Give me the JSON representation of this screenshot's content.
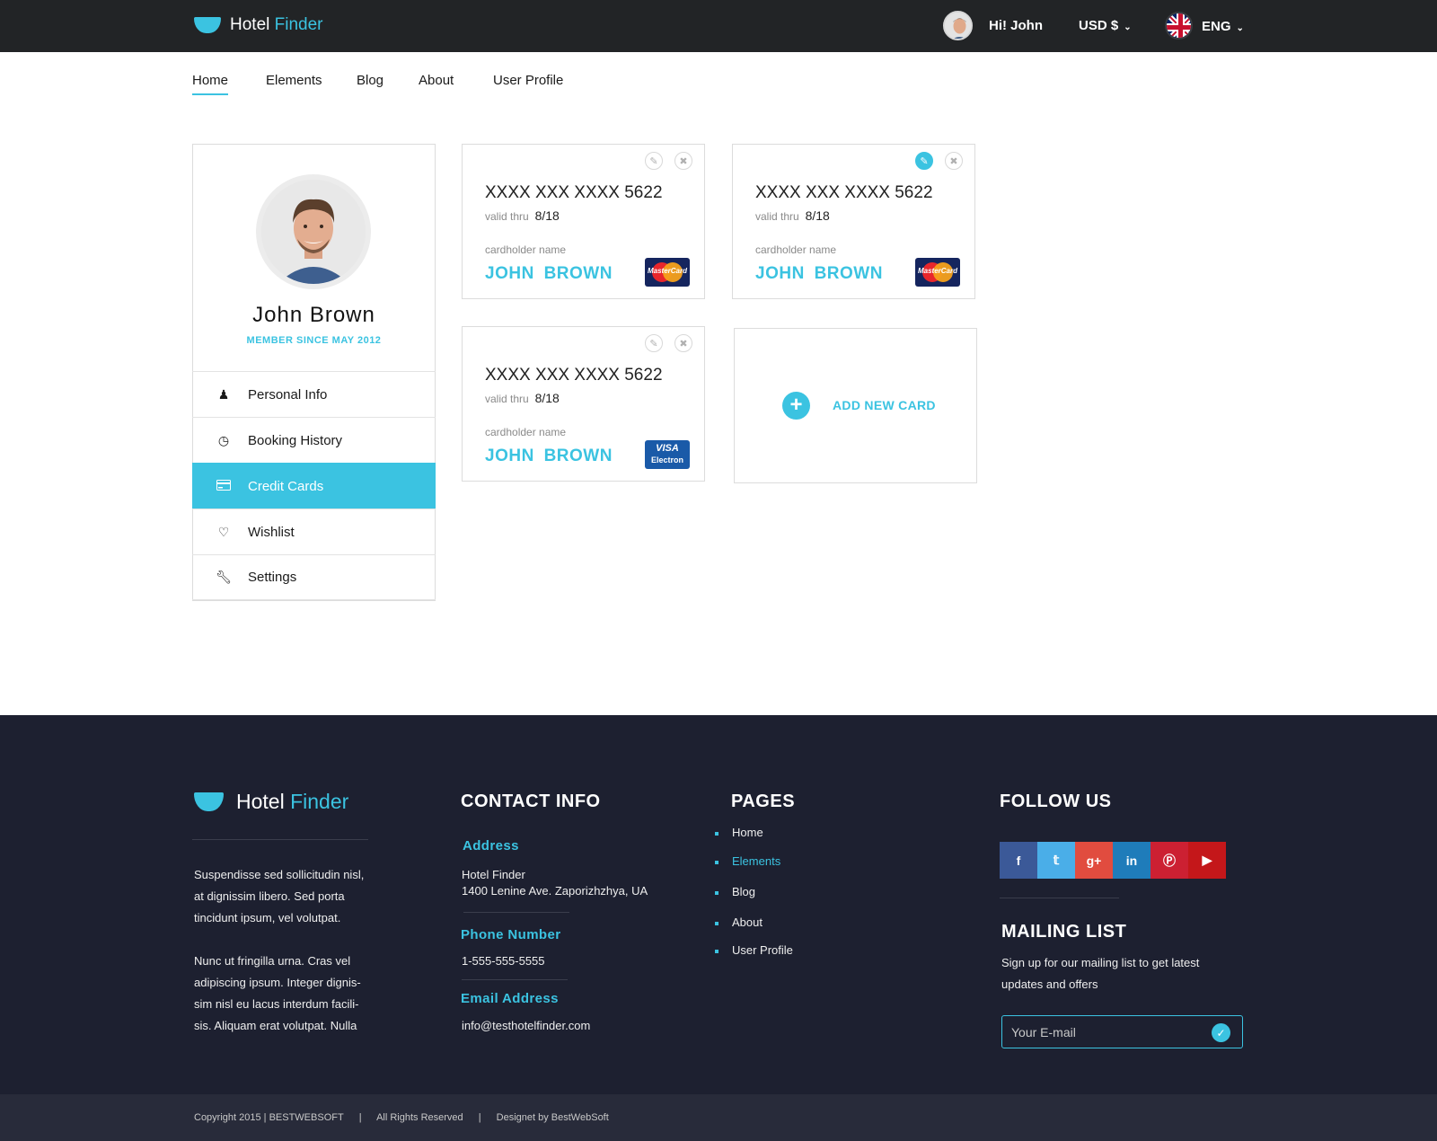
{
  "brand": {
    "hotel": "Hotel",
    "finder": "Finder"
  },
  "header": {
    "greeting": "Hi! John",
    "currency": "USD  $",
    "language": "ENG"
  },
  "nav": [
    "Home",
    "Elements",
    "Blog",
    "About",
    "User Profile"
  ],
  "profile": {
    "name": "John  Brown",
    "member_since": "MEMBER SINCE MAY 2012",
    "menu": [
      {
        "label": "Personal Info",
        "icon": "user-icon"
      },
      {
        "label": "Booking History",
        "icon": "clock-icon"
      },
      {
        "label": "Credit Cards",
        "icon": "credit-card-icon",
        "active": true
      },
      {
        "label": "Wishlist",
        "icon": "heart-icon"
      },
      {
        "label": "Settings",
        "icon": "wrench-icon"
      }
    ]
  },
  "cards": [
    {
      "number": "XXXX XXX XXXX 5622",
      "valid_label": "valid thru",
      "valid": "8/18",
      "holder_label": "cardholder name",
      "holder": "JOHN  BROWN",
      "brand": "MasterCard"
    },
    {
      "number": "XXXX XXX XXXX 5622",
      "valid_label": "valid thru",
      "valid": "8/18",
      "holder_label": "cardholder name",
      "holder": "JOHN  BROWN",
      "brand": "MasterCard",
      "edit_active": true
    },
    {
      "number": "XXXX XXX XXXX 5622",
      "valid_label": "valid thru",
      "valid": "8/18",
      "holder_label": "cardholder name",
      "holder": "JOHN  BROWN",
      "brand_top": "VISA",
      "brand_bottom": "Electron"
    }
  ],
  "add_card": "ADD NEW CARD",
  "footer": {
    "about_p1": "Suspendisse sed sollicitudin nisl, at dignissim libero. Sed porta tincidunt ipsum, vel volutpat.",
    "about_p2": "Nunc ut fringilla urna. Cras vel adipiscing ipsum. Integer dignis-sim nisl eu lacus interdum facili-sis. Aliquam erat volutpat. Nulla",
    "contact_title": "CONTACT INFO",
    "address_label": "Address",
    "address_line1": "Hotel Finder",
    "address_line2": "1400 Lenine Ave. Zaporizhzhya, UA",
    "phone_label": "Phone Number",
    "phone": "1-555-555-5555",
    "email_label": "Email Address",
    "email": "info@testhotelfinder.com",
    "pages_title": "PAGES",
    "pages": [
      "Home",
      "Elements",
      "Blog",
      "About",
      "User Profile"
    ],
    "follow_title": "FOLLOW US",
    "social": [
      {
        "label": "f",
        "color": "#3b5998"
      },
      {
        "label": "t",
        "color": "#4aaee8"
      },
      {
        "label": "g+",
        "color": "#e14c3f"
      },
      {
        "label": "in",
        "color": "#1f7cba"
      },
      {
        "label": "p",
        "color": "#cc2032"
      },
      {
        "label": "yt",
        "color": "#c4171a"
      }
    ],
    "mailing_title": "MAILING LIST",
    "mailing_text": "Sign up for our mailing list to get latest updates and offers",
    "email_placeholder": "Your E-mail"
  },
  "copyright": {
    "c1": "Copyright   2015   | BESTWEBSOFT",
    "sep": "|",
    "c2": "All Rights Reserved",
    "c3": "Designet by BestWebSoft"
  },
  "colors": {
    "accent": "#3bc3e1",
    "topbar": "#222426",
    "footer": "#1d2030",
    "bottombar": "#282b3a"
  }
}
